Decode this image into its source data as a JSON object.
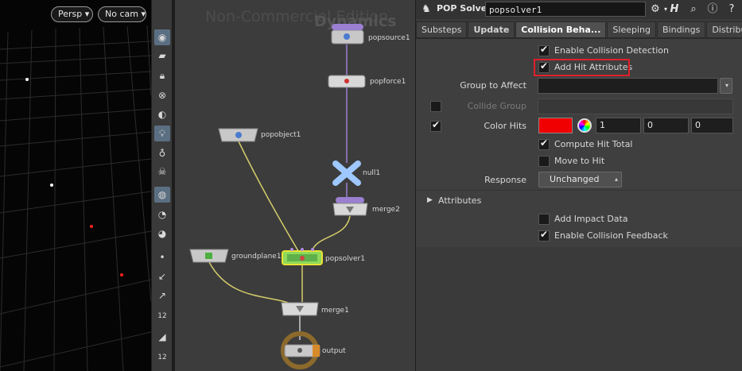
{
  "viewport": {
    "persp_label": "Persp",
    "cam_label": "No cam"
  },
  "toolbar_icons": [
    "view-icon",
    "select-icon",
    "lock-icon",
    "display-icon",
    "shading-icon",
    "light-icon",
    "bulb-icon",
    "skull-icon",
    "ghost-icon",
    "eye-icon",
    "camera-icon",
    "point-icon",
    "normals-icon",
    "vector-icon",
    "numbers-icon",
    "brush-icon",
    "numbers2-icon"
  ],
  "network": {
    "watermark": "Non-Commercial Edition",
    "context_title": "Dynamics",
    "nodes": [
      {
        "name": "popsource1"
      },
      {
        "name": "popforce1"
      },
      {
        "name": "popobject1"
      },
      {
        "name": "null1"
      },
      {
        "name": "merge2"
      },
      {
        "name": "groundplane1"
      },
      {
        "name": "popsolver1"
      },
      {
        "name": "merge1"
      },
      {
        "name": "output"
      }
    ]
  },
  "params": {
    "node_type": "POP Solver",
    "node_name": "popsolver1",
    "tabs": [
      {
        "label": "Substeps"
      },
      {
        "label": "Update"
      },
      {
        "label": "Collision Beha..."
      },
      {
        "label": "Sleeping"
      },
      {
        "label": "Bindings"
      },
      {
        "label": "Distribution"
      }
    ],
    "enable_collision_detection": "Enable Collision Detection",
    "add_hit_attributes": "Add Hit Attributes",
    "group_to_affect_label": "Group to Affect",
    "group_to_affect_value": "",
    "collide_group_label": "Collide Group",
    "collide_group_value": "",
    "color_hits_label": "Color Hits",
    "color_hits_color": "#ff0000",
    "color_values": [
      "1",
      "0",
      "0"
    ],
    "compute_hit_total": "Compute Hit Total",
    "move_to_hit": "Move to Hit",
    "response_label": "Response",
    "response_value": "Unchanged",
    "attributes_folder": "Attributes",
    "add_impact_data": "Add Impact Data",
    "enable_collision_feedback": "Enable Collision Feedback"
  }
}
